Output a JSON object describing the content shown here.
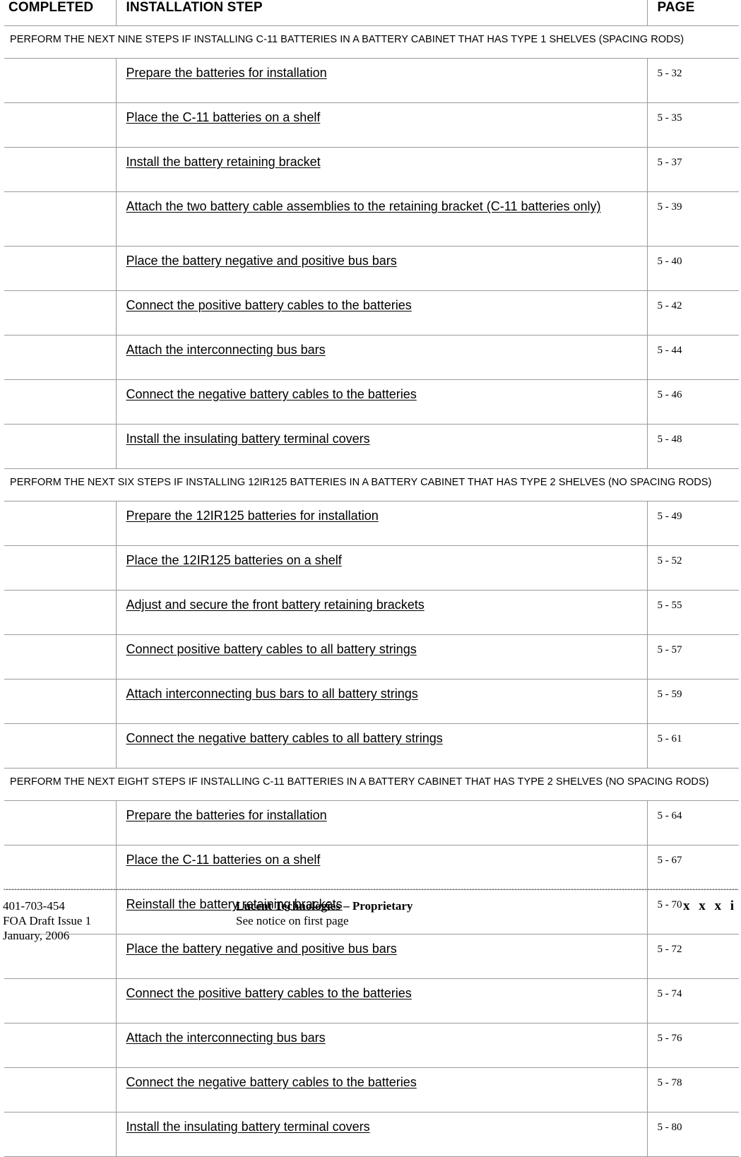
{
  "table": {
    "headers": {
      "completed": "COMPLETED",
      "step": "INSTALLATION STEP",
      "page": "PAGE"
    },
    "sections": [
      {
        "note": "PERFORM THE NEXT NINE STEPS IF INSTALLING C-11 BATTERIES IN A BATTERY CABINET THAT HAS TYPE 1 SHELVES (SPACING RODS)",
        "rows": [
          {
            "step": "Prepare the batteries for installation",
            "page": "5 - 32"
          },
          {
            "step": "Place the C-11 batteries on a shelf",
            "page": "5 - 35"
          },
          {
            "step": "Install the battery retaining bracket",
            "page": "5 - 37"
          },
          {
            "step": "Attach the two battery cable assemblies to the retaining bracket (C-11 batteries only)",
            "page": "5 - 39",
            "tall": true
          },
          {
            "step": "Place the battery negative and positive bus bars",
            "page": "5 - 40"
          },
          {
            "step": "Connect the positive battery cables to the batteries",
            "page": "5 - 42"
          },
          {
            "step": "Attach the interconnecting bus bars",
            "page": "5 - 44"
          },
          {
            "step": "Connect the negative battery cables to the batteries",
            "page": "5 - 46"
          },
          {
            "step": "Install the insulating battery terminal covers",
            "page": "5 - 48"
          }
        ]
      },
      {
        "note": "PERFORM THE NEXT SIX STEPS IF INSTALLING 12IR125 BATTERIES IN A BATTERY CABINET THAT HAS TYPE 2 SHELVES (NO SPACING RODS)",
        "rows": [
          {
            "step": "Prepare the 12IR125 batteries for installation",
            "page": "5 - 49"
          },
          {
            "step": "Place the 12IR125 batteries on a shelf",
            "page": "5 - 52"
          },
          {
            "step": "Adjust and secure the front battery retaining brackets",
            "page": "5 - 55"
          },
          {
            "step": "Connect positive battery cables to all battery strings",
            "page": "5 - 57"
          },
          {
            "step": "Attach interconnecting bus bars to all battery strings",
            "page": "5 - 59"
          },
          {
            "step": "Connect the negative battery cables to all battery strings",
            "page": "5 - 61"
          }
        ]
      },
      {
        "note": "PERFORM THE NEXT EIGHT STEPS IF INSTALLING C-11 BATTERIES IN A BATTERY CABINET THAT HAS TYPE 2 SHELVES (NO SPACING RODS)",
        "rows": [
          {
            "step": "Prepare the batteries for installation",
            "page": "5 - 64"
          },
          {
            "step": "Place the C-11 batteries on a shelf",
            "page": "5 - 67"
          },
          {
            "step": "Reinstall the battery retaining brackets",
            "page": "5 - 70"
          },
          {
            "step": "Place the battery negative and positive bus bars",
            "page": "5 - 72"
          },
          {
            "step": "Connect the positive battery cables to the batteries",
            "page": "5 - 74"
          },
          {
            "step": "Attach the interconnecting bus bars",
            "page": "5 - 76"
          },
          {
            "step": "Connect the negative battery cables to the batteries",
            "page": "5 - 78"
          },
          {
            "step": "Install the insulating battery terminal covers",
            "page": "5 - 80"
          }
        ]
      }
    ]
  },
  "footer": {
    "doc_number": "401-703-454",
    "issue": "FOA Draft Issue 1",
    "date": "January, 2006",
    "proprietary_title": "Lucent Technologies – Proprietary",
    "proprietary_note": "See notice on first page",
    "page_number": "x x x i"
  }
}
